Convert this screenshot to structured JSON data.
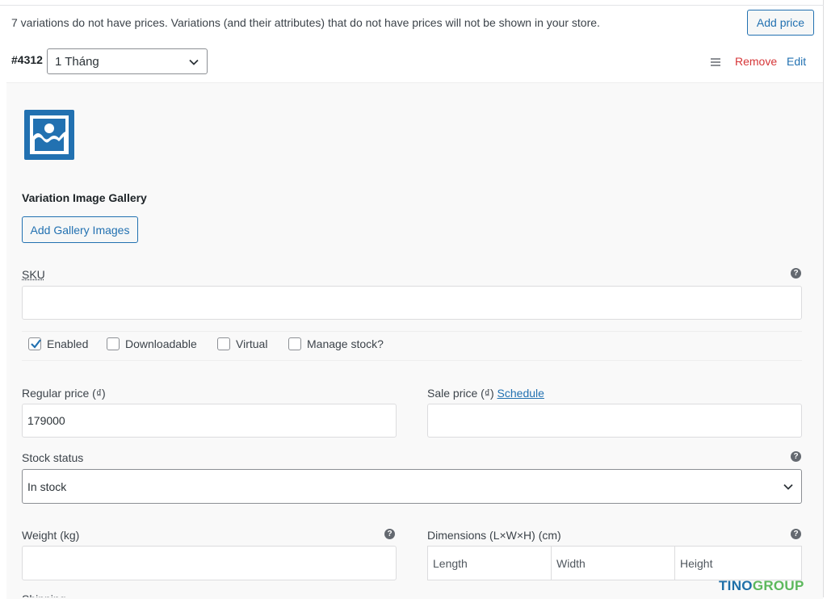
{
  "notice": {
    "message": "7 variations do not have prices. Variations (and their attributes) that do not have prices will not be shown in your store.",
    "add_price_label": "Add price"
  },
  "variation": {
    "id": "#4312",
    "attribute_value": "1 Tháng",
    "remove_label": "Remove",
    "edit_label": "Edit"
  },
  "image": {
    "icon": "image-placeholder-icon"
  },
  "gallery": {
    "title": "Variation Image Gallery",
    "button_label": "Add Gallery Images"
  },
  "sku": {
    "label": "SKU",
    "value": ""
  },
  "options": [
    {
      "label": "Enabled",
      "checked": true
    },
    {
      "label": "Downloadable",
      "checked": false
    },
    {
      "label": "Virtual",
      "checked": false
    },
    {
      "label": "Manage stock?",
      "checked": false
    }
  ],
  "pricing": {
    "regular_label": "Regular price (₫)",
    "regular_value": "179000",
    "sale_label": "Sale price (₫)",
    "schedule_link": "Schedule",
    "sale_value": ""
  },
  "stock": {
    "label": "Stock status",
    "selected": "In stock"
  },
  "weight": {
    "label": "Weight (kg)",
    "value": ""
  },
  "dimensions": {
    "label": "Dimensions (L×W×H) (cm)",
    "length_placeholder": "Length",
    "width_placeholder": "Width",
    "height_placeholder": "Height"
  },
  "next_field_label": "Shipping class",
  "watermark": {
    "part1": "TINO",
    "part2": "GROUP"
  },
  "colors": {
    "accent": "#2271b1",
    "remove": "#d63638",
    "placeholder_icon": "#2271b1",
    "watermark_blue": "#1e6fa8",
    "watermark_green": "#5cb85c"
  }
}
